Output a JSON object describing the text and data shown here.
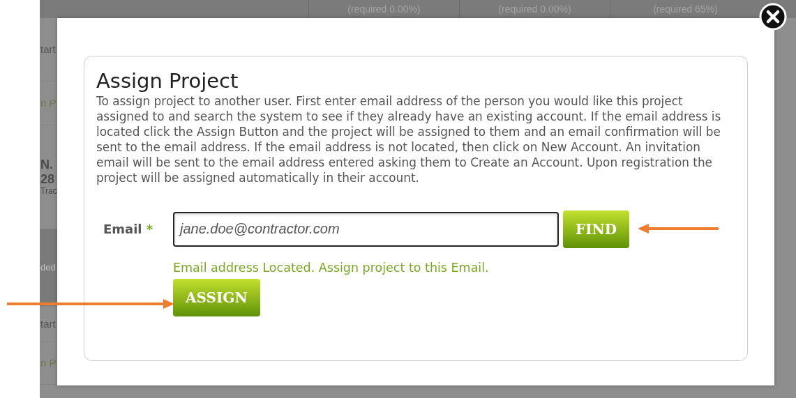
{
  "background": {
    "header_cells": [
      "(required 0.00%)",
      "(required 0.00%)",
      "(required 65%)"
    ],
    "side_rows": [
      {
        "kind": "plain",
        "texts": [
          "tart"
        ]
      },
      {
        "kind": "link",
        "texts": [
          "n P"
        ]
      },
      {
        "kind": "info",
        "texts": [
          "N.",
          "28",
          "Trac"
        ]
      },
      {
        "kind": "band",
        "texts": [
          "ded"
        ]
      },
      {
        "kind": "plain",
        "texts": [
          "tart"
        ]
      },
      {
        "kind": "link",
        "texts": [
          "n P"
        ]
      }
    ]
  },
  "dialog": {
    "title": "Assign Project",
    "description": "To assign project to another user. First enter email address of the person you would like this project assigned to and search the system to see if they already have an existing account. If the email address is located click the Assign Button and the project will be assigned to them and an email confirmation will be sent to the email address. If the email address is not located, then click on New Account. An invitation email will be sent to the email address entered asking them to Create an Account. Upon registration the project will be assigned automatically in their account.",
    "email_label": "Email",
    "required_mark": "*",
    "email_value": "jane.doe@contractor.com",
    "find_button": "FIND",
    "message": "Email address Located. Assign project to this Email.",
    "assign_button": "ASSIGN"
  }
}
